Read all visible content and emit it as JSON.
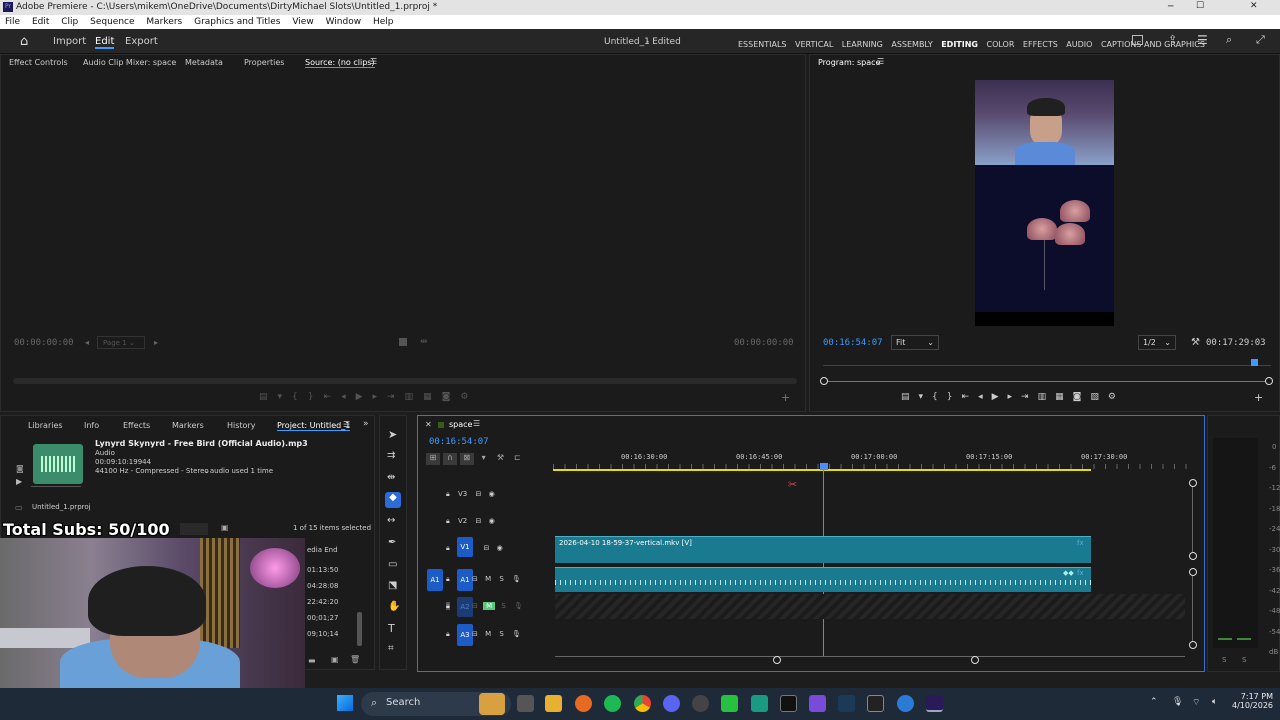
{
  "window": {
    "title": "Adobe Premiere - C:\\Users\\mikem\\OneDrive\\Documents\\DirtyMichael Slots\\Untitled_1.prproj *",
    "minimize": "─",
    "maximize": "☐",
    "close": "✕"
  },
  "menu": [
    "File",
    "Edit",
    "Clip",
    "Sequence",
    "Markers",
    "Graphics and Titles",
    "View",
    "Window",
    "Help"
  ],
  "header": {
    "tabs": [
      "Import",
      "Edit",
      "Export"
    ],
    "project_title": "Untitled_1",
    "edited": "- Edited",
    "workspaces": [
      "ESSENTIALS",
      "VERTICAL",
      "LEARNING",
      "ASSEMBLY",
      "EDITING",
      "COLOR",
      "EFFECTS",
      "AUDIO",
      "CAPTIONS AND GRAPHICS"
    ],
    "active_workspace": "EDITING"
  },
  "source_panel": {
    "tabs": [
      "Effect Controls",
      "Audio Clip Mixer: space",
      "Metadata",
      "Properties",
      "Source: (no clips)"
    ],
    "timecode_left": "00:00:00:00",
    "page": "Page 1",
    "timecode_right": "00:00:00:00"
  },
  "program": {
    "title": "Program: space",
    "timecode": "00:16:54:07",
    "fit": "Fit",
    "resolution": "1/2",
    "duration": "00:17:29:03"
  },
  "project_panel": {
    "tabs": [
      "Libraries",
      "Info",
      "Effects",
      "Markers",
      "History",
      "Project: Untitled_1"
    ],
    "file_name": "Lynyrd Skynyrd - Free Bird (Official Audio).mp3",
    "file_type": "Audio",
    "file_duration": "00:09:10:19944",
    "file_info": "44100 Hz - Compressed - Stereo",
    "usage": "audio used 1 time",
    "project_file": "Untitled_1.prproj",
    "items_selected": "1 of 15 items selected",
    "column": "edia End",
    "rows": [
      "01:13:50",
      "04:28:08",
      "22:42:20",
      "00;01;27",
      "09;10;14"
    ]
  },
  "overlay": {
    "subs": "Total Subs: 50/100"
  },
  "timeline": {
    "sequence": "space",
    "timecode": "00:16:54:07",
    "ruler": [
      "00:16:30:00",
      "00:16:45:00",
      "00:17:00:00",
      "00:17:15:00",
      "00:17:30:00"
    ],
    "tracks": [
      "V3",
      "V2",
      "V1",
      "A1",
      "A2",
      "A3"
    ],
    "src_v": "V1",
    "src_a": "A1",
    "clip": "2026-04-10 18-59-37-vertical.mkv [V]",
    "mute": "M",
    "solo": "S"
  },
  "meter": {
    "labels": [
      "0",
      "-6",
      "-12",
      "-18",
      "-24",
      "-30",
      "-36",
      "-42",
      "-48",
      "-54",
      "dB"
    ],
    "bottom": [
      "S",
      "S"
    ]
  },
  "taskbar": {
    "search": "Search",
    "time": "7:17 PM",
    "date": "4/10/2026"
  }
}
